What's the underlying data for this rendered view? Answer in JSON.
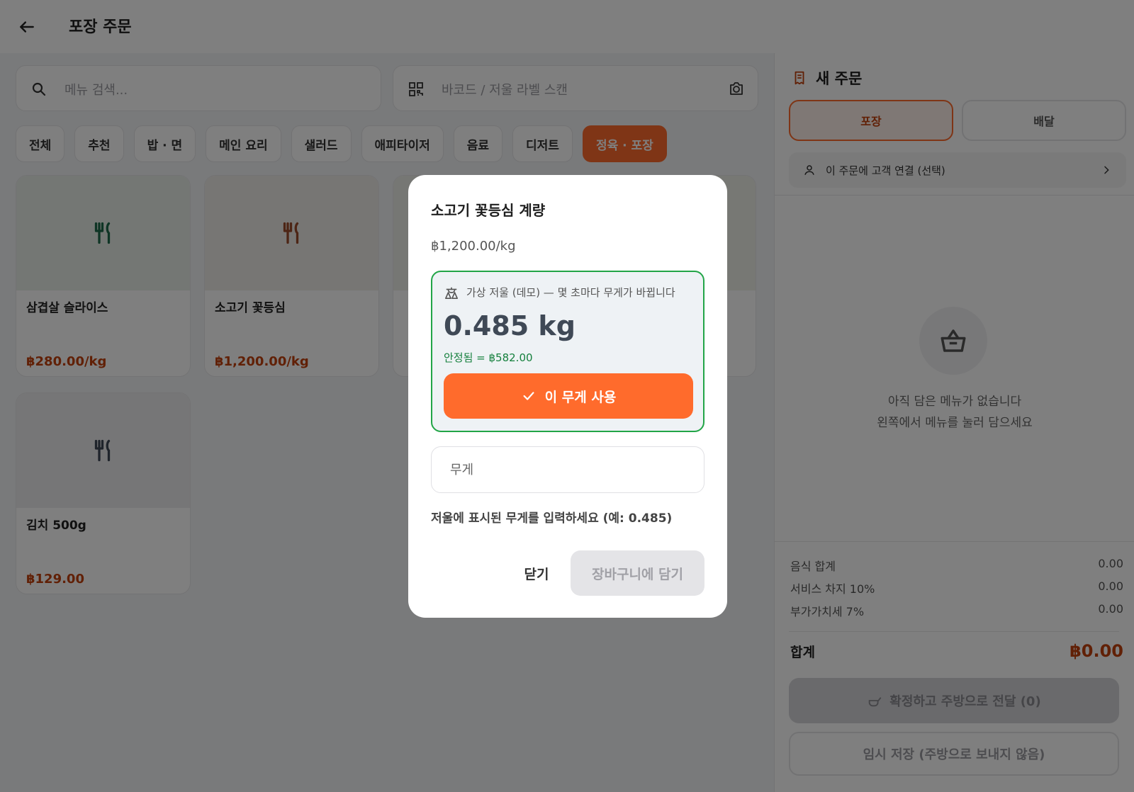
{
  "header": {
    "title": "포장 주문"
  },
  "search": {
    "menu_placeholder": "메뉴 검색...",
    "barcode_placeholder": "바코드 / 저울 라벨 스캔"
  },
  "categories": [
    {
      "label": "전체",
      "active": false
    },
    {
      "label": "추천",
      "active": false
    },
    {
      "label": "밥 · 면",
      "active": false
    },
    {
      "label": "메인 요리",
      "active": false
    },
    {
      "label": "샐러드",
      "active": false
    },
    {
      "label": "애피타이저",
      "active": false
    },
    {
      "label": "음료",
      "active": false
    },
    {
      "label": "디저트",
      "active": false
    },
    {
      "label": "정육 · 포장",
      "active": true
    }
  ],
  "products": [
    {
      "name": "삼겹살 슬라이스",
      "price": "฿280.00/kg",
      "thumb_color": "#e8efe8"
    },
    {
      "name": "소고기 꽃등심",
      "price": "฿1,200.00/kg",
      "thumb_color": "#efece8"
    },
    {
      "name": "김치 500g",
      "price": "฿129.00",
      "thumb_color": "#ececee"
    }
  ],
  "order": {
    "title": "새 주문",
    "type_takeout": "포장",
    "type_delivery": "배달",
    "customer_link": "이 주문에 고객 연결 (선택)",
    "empty_line1": "아직 담은 메뉴가 없습니다",
    "empty_line2": "왼쪽에서 메뉴를 눌러 담으세요",
    "food_total_label": "음식 합계",
    "food_total_value": "0.00",
    "service_label": "서비스 차지 10%",
    "service_value": "0.00",
    "vat_label": "부가가치세 7%",
    "vat_value": "0.00",
    "total_label": "합계",
    "total_value": "฿0.00",
    "confirm_button": "확정하고 주방으로 전달 (0)",
    "save_button": "임시 저장 (주방으로 보내지 않음)"
  },
  "modal": {
    "title": "소고기 꽃등심 계량",
    "unit_price": "฿1,200.00/kg",
    "scale_note": "가상 저울 (데모) — 몇 초마다 무게가 바뀝니다",
    "weight_display": "0.485 kg",
    "stable_text": "안정됨 = ฿582.00",
    "use_weight_button": "이 무게 사용",
    "weight_placeholder": "무게",
    "weight_help": "저울에 표시된 무게를 입력하세요 (예: 0.485)",
    "close_button": "닫기",
    "add_to_cart_button": "장바구니에 담기"
  },
  "colors": {
    "accent": "#ff6b2c",
    "price": "#c2410c",
    "stable": "#15803d",
    "scale_border": "#22a547"
  }
}
